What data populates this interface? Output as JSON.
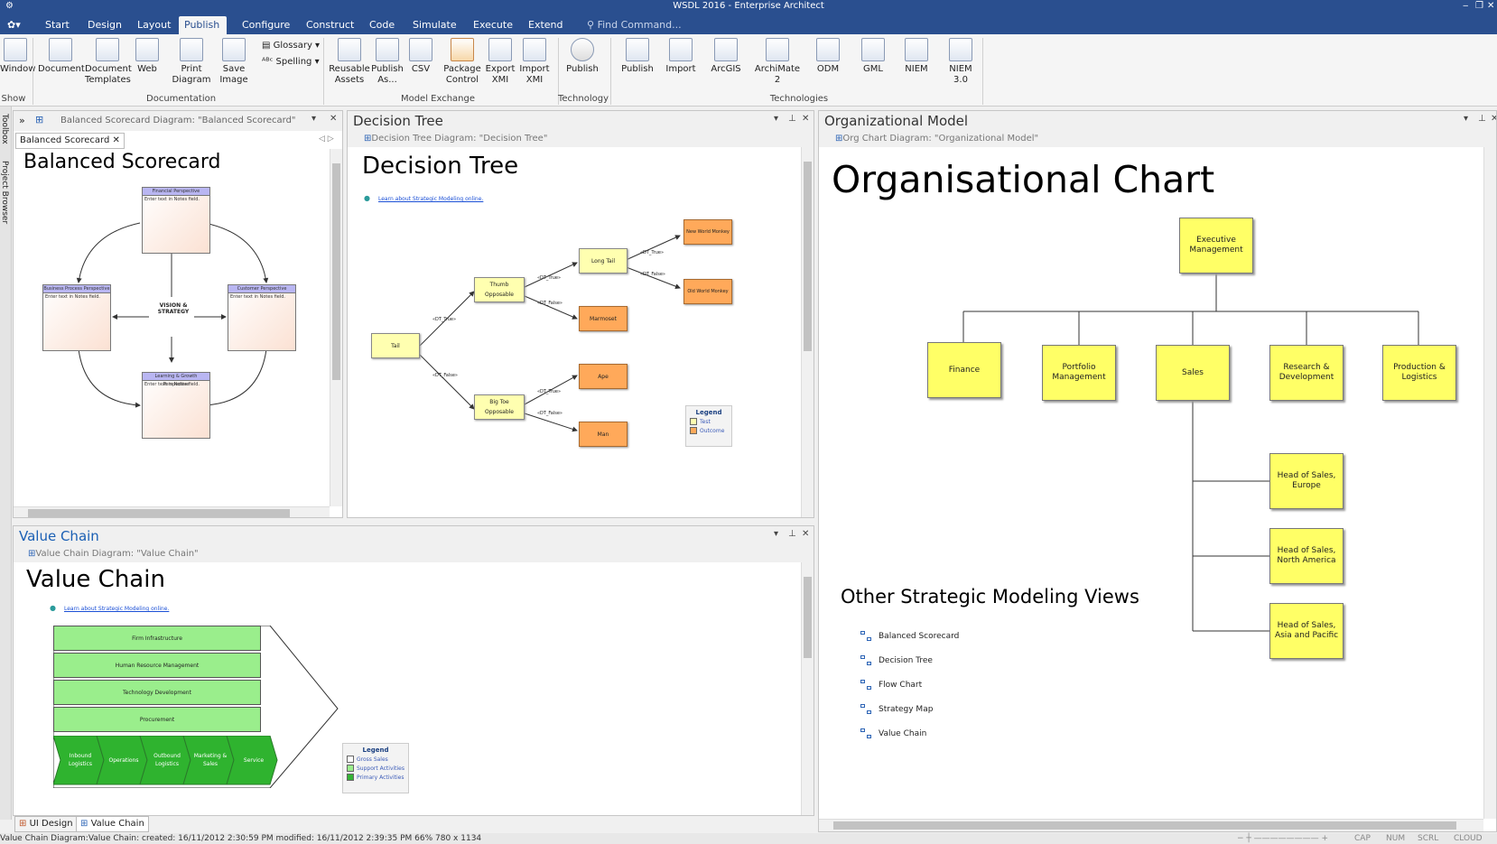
{
  "window": {
    "title": "WSDL 2016 - Enterprise Architect",
    "minimize": "‒",
    "restore": "❐",
    "close": "✕"
  },
  "menu": {
    "items": [
      "Start",
      "Design",
      "Layout",
      "Publish",
      "Configure",
      "Construct",
      "Code",
      "Simulate",
      "Execute",
      "Extend"
    ],
    "active": "Publish",
    "find_placeholder": "Find Command..."
  },
  "ribbon": {
    "buttons": [
      {
        "id": "window",
        "label": "Window"
      },
      {
        "id": "document",
        "label": "Document"
      },
      {
        "id": "document-templates",
        "label": "Document Templates"
      },
      {
        "id": "web",
        "label": "Web"
      },
      {
        "id": "print-diagram",
        "label": "Print Diagram"
      },
      {
        "id": "save-image",
        "label": "Save Image"
      },
      {
        "id": "reusable-assets",
        "label": "Reusable Assets"
      },
      {
        "id": "publish-as",
        "label": "Publish As..."
      },
      {
        "id": "csv",
        "label": "CSV"
      },
      {
        "id": "package-control",
        "label": "Package Control"
      },
      {
        "id": "export-xmi",
        "label": "Export XMI"
      },
      {
        "id": "import-xmi",
        "label": "Import XMI"
      },
      {
        "id": "publish-tech",
        "label": "Publish"
      },
      {
        "id": "publish",
        "label": "Publish"
      },
      {
        "id": "import",
        "label": "Import"
      },
      {
        "id": "arcgis",
        "label": "ArcGIS"
      },
      {
        "id": "archimate",
        "label": "ArchiMate 2"
      },
      {
        "id": "odm",
        "label": "ODM"
      },
      {
        "id": "gml",
        "label": "GML"
      },
      {
        "id": "niem",
        "label": "NIEM"
      },
      {
        "id": "niem3",
        "label": "NIEM 3.0"
      }
    ],
    "glossary": "Glossary",
    "spelling": "Spelling",
    "groups": {
      "show": "Show",
      "documentation": "Documentation",
      "model_exchange": "Model Exchange",
      "technology": "Technology",
      "technologies": "Technologies"
    }
  },
  "sidebar": {
    "toolbox": "Toolbox",
    "project_browser": "Project Browser"
  },
  "balanced": {
    "header": "Balanced Scorecard Diagram: \"Balanced Scorecard\"",
    "tab": "Balanced Scorecard",
    "title": "Balanced Scorecard",
    "center": "VISION & STRATEGY",
    "boxes": [
      {
        "header": "Financial Perspective",
        "body": "Enter text in Notes field."
      },
      {
        "header": "Business Process Perspective",
        "body": "Enter text in Notes field."
      },
      {
        "header": "Customer Perspective",
        "body": "Enter text in Notes field."
      },
      {
        "header": "Learning & Growth Perspective",
        "body": "Enter text in Notes field."
      }
    ]
  },
  "decision": {
    "panel_title": "Decision Tree",
    "subheader": "Decision Tree Diagram: \"Decision Tree\"",
    "title": "Decision Tree",
    "link": "Learn about Strategic Modeling online.",
    "nodes": {
      "tail": "Tail",
      "thumb": "Thumb Opposable",
      "bigtoe": "Big Toe Opposable",
      "longtail": "Long Tail",
      "newworld": "New World Monkey",
      "oldworld": "Old World Monkey",
      "marmoset": "Marmoset",
      "ape": "Ape",
      "man": "Man"
    },
    "edge_true": "«DT_True»",
    "edge_false": "«DT_False»",
    "legend": {
      "title": "Legend",
      "items": [
        {
          "label": "Test",
          "color": "#ffffb0"
        },
        {
          "label": "Outcome",
          "color": "#ffa95a"
        }
      ]
    }
  },
  "org": {
    "panel_title": "Organizational Model",
    "subheader": "Org Chart Diagram: \"Organizational Model\"",
    "title": "Organisational Chart",
    "exec": "Executive Management",
    "departments": [
      "Finance",
      "Portfolio Management",
      "Sales",
      "Research & Development",
      "Production & Logistics"
    ],
    "heads": [
      "Head of Sales, Europe",
      "Head of Sales, North America",
      "Head of Sales, Asia and Pacific"
    ],
    "views_title": "Other Strategic Modeling Views",
    "views": [
      "Balanced Scorecard",
      "Decision Tree",
      "Flow Chart",
      "Strategy Map",
      "Value Chain"
    ]
  },
  "value": {
    "panel_title": "Value Chain",
    "subheader": "Value Chain Diagram: \"Value Chain\"",
    "title": "Value Chain",
    "link": "Learn about Strategic Modeling online.",
    "support": [
      "Firm Infrastructure",
      "Human Resource Management",
      "Technology Development",
      "Procurement"
    ],
    "primary": [
      "Inbound Logistics",
      "Operations",
      "Outbound Logistics",
      "Marketing & Sales",
      "Service"
    ],
    "legend": {
      "title": "Legend",
      "items": [
        {
          "label": "Gross Sales",
          "color": "#ffffff"
        },
        {
          "label": "Support Activities",
          "color": "#9aee8c"
        },
        {
          "label": "Primary Activities",
          "color": "#35b335"
        }
      ]
    }
  },
  "bottom_tabs": [
    "UI Design",
    "Value Chain"
  ],
  "status": {
    "text": "Value Chain Diagram:Value Chain:   created: 16/11/2012 2:30:59 PM  modified: 16/11/2012 2:39:35 PM   66%   780 x 1134",
    "indicators": [
      "CAP",
      "NUM",
      "SCRL",
      "CLOUD"
    ]
  }
}
